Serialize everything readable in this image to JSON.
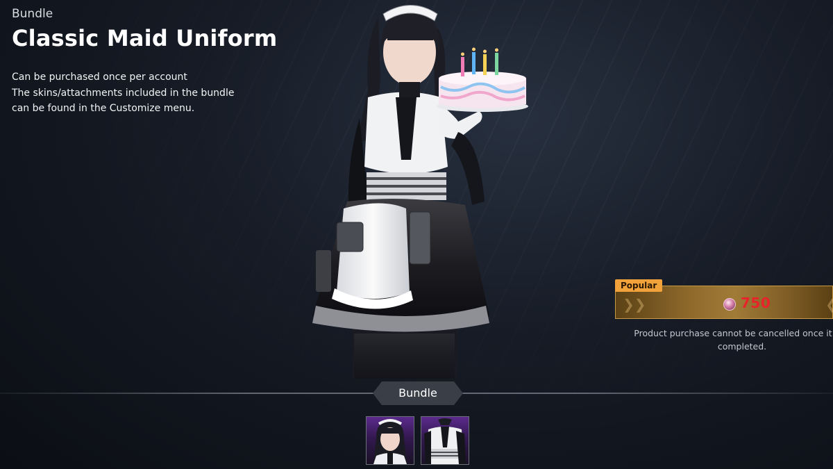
{
  "header": {
    "category": "Bundle",
    "title": "Classic Maid Uniform",
    "description_lines": [
      "Can be purchased once per account",
      "The skins/attachments included in the bundle",
      "can be found in the Customize menu."
    ]
  },
  "purchase": {
    "badge": "Popular",
    "price": "750",
    "currency_icon": "premium-gem-icon",
    "notice_lines": [
      "Product purchase cannot be cancelled once it has",
      "completed."
    ]
  },
  "contents": {
    "section_label": "Bundle",
    "items": [
      {
        "name": "maid-headdress-skin"
      },
      {
        "name": "maid-outfit-skin"
      }
    ]
  },
  "colors": {
    "popular_badge": "#f2a23a",
    "price_text": "#e8232a",
    "button_gold": "#a07b37",
    "item_tile": "#5b2a8c"
  }
}
